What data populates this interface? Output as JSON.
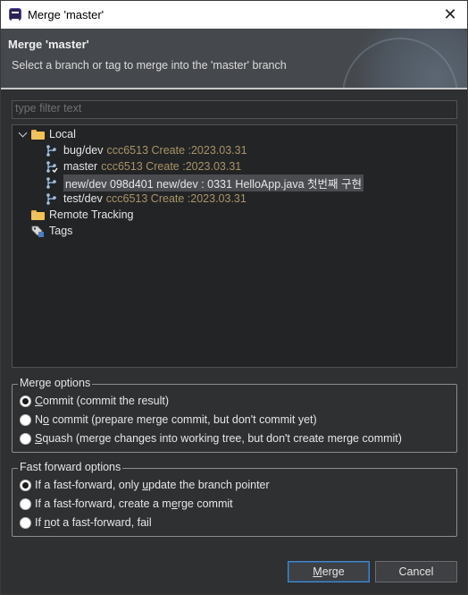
{
  "window": {
    "title": "Merge 'master'"
  },
  "banner": {
    "title": "Merge 'master'",
    "description": "Select a branch or tag to merge into the 'master' branch"
  },
  "filter": {
    "placeholder": "type filter text",
    "value": ""
  },
  "tree": {
    "local": {
      "label": "Local",
      "expanded": true,
      "branches": [
        {
          "name": "bug/dev",
          "meta": "ccc6513 Create :2023.03.31",
          "icon": "branch-icon",
          "selected": false
        },
        {
          "name": "master",
          "meta": "ccc6513 Create :2023.03.31",
          "icon": "branch-checked-out-icon",
          "selected": false
        },
        {
          "name": "new/dev 098d401 new/dev : 0331 HelloApp.java 첫번째 구현",
          "meta": "",
          "icon": "branch-icon",
          "selected": true
        },
        {
          "name": "test/dev",
          "meta": "ccc6513 Create :2023.03.31",
          "icon": "branch-icon",
          "selected": false
        }
      ]
    },
    "remote_tracking": {
      "label": "Remote Tracking",
      "icon": "folder-icon"
    },
    "tags": {
      "label": "Tags",
      "icon": "tags-icon"
    }
  },
  "merge_options": {
    "title": "Merge options",
    "options": [
      {
        "pre": "",
        "mnemonic": "C",
        "post": "ommit (commit the result)",
        "checked": true
      },
      {
        "pre": "N",
        "mnemonic": "o",
        "post": " commit (prepare merge commit, but don't commit yet)",
        "checked": false
      },
      {
        "pre": "",
        "mnemonic": "S",
        "post": "quash (merge changes into working tree, but don't create merge commit)",
        "checked": false
      }
    ]
  },
  "fast_forward_options": {
    "title": "Fast forward options",
    "options": [
      {
        "pre": "If a fast-forward, only ",
        "mnemonic": "u",
        "post": "pdate the branch pointer",
        "checked": true
      },
      {
        "pre": "If a fast-forward, create a m",
        "mnemonic": "e",
        "post": "rge commit",
        "checked": false
      },
      {
        "pre": "If ",
        "mnemonic": "n",
        "post": "ot a fast-forward, fail",
        "checked": false
      }
    ]
  },
  "buttons": {
    "merge": {
      "mnemonic": "M",
      "rest": "erge"
    },
    "cancel": "Cancel"
  },
  "colors": {
    "background": "#2f3032",
    "tree_background": "#232426",
    "meta_text": "#a89466",
    "default_button_border": "#4a86c8"
  }
}
